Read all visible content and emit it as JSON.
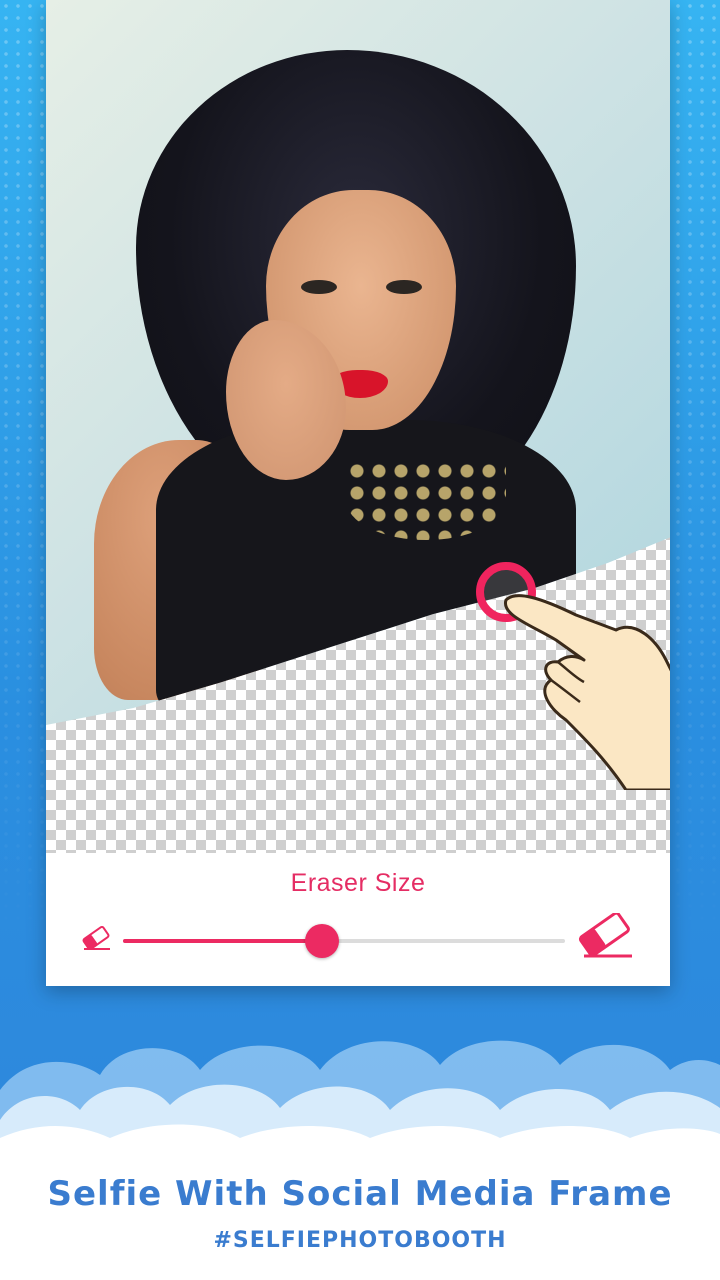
{
  "editor": {
    "eraser_label": "Eraser Size",
    "eraser_size_fraction": 0.45,
    "accent_color": "#ec2a62",
    "icons": {
      "small": "eraser-icon",
      "large": "eraser-icon"
    }
  },
  "promo": {
    "headline": "Selfie With Social Media Frame",
    "hashtag": "#SELFIEPHOTOBOOTH",
    "text_color": "#3a7ccf",
    "background_color": "#2f8fe0"
  }
}
